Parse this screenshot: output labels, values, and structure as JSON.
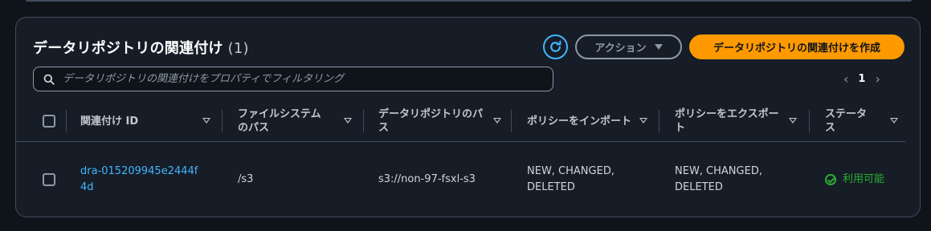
{
  "header": {
    "title": "データリポジトリの関連付け",
    "count": "(1)",
    "actions_label": "アクション",
    "create_label": "データリポジトリの関連付けを作成"
  },
  "search": {
    "placeholder": "データリポジトリの関連付けをプロパティでフィルタリング"
  },
  "pagination": {
    "current_page": "1"
  },
  "table": {
    "columns": [
      "関連付け ID",
      "ファイルシステムのパス",
      "データリポジトリのパス",
      "ポリシーをインポート",
      "ポリシーをエクスポート",
      "ステータス"
    ],
    "rows": [
      {
        "association_id": "dra-015209945e2444f4d",
        "file_system_path": "/s3",
        "data_repository_path": "s3://non-97-fsxl-s3",
        "import_policy": "NEW, CHANGED, DELETED",
        "export_policy": "NEW, CHANGED, DELETED",
        "status": "利用可能"
      }
    ]
  },
  "colors": {
    "accent_link": "#42b4ff",
    "primary_button": "#ff9900",
    "status_available": "#29ad32",
    "panel_bg": "#161d26",
    "page_bg": "#0f141a"
  },
  "icons": [
    "refresh-icon",
    "caret-down-icon",
    "search-icon",
    "chevron-left-icon",
    "chevron-right-icon",
    "sort-icon",
    "status-ok-icon"
  ]
}
